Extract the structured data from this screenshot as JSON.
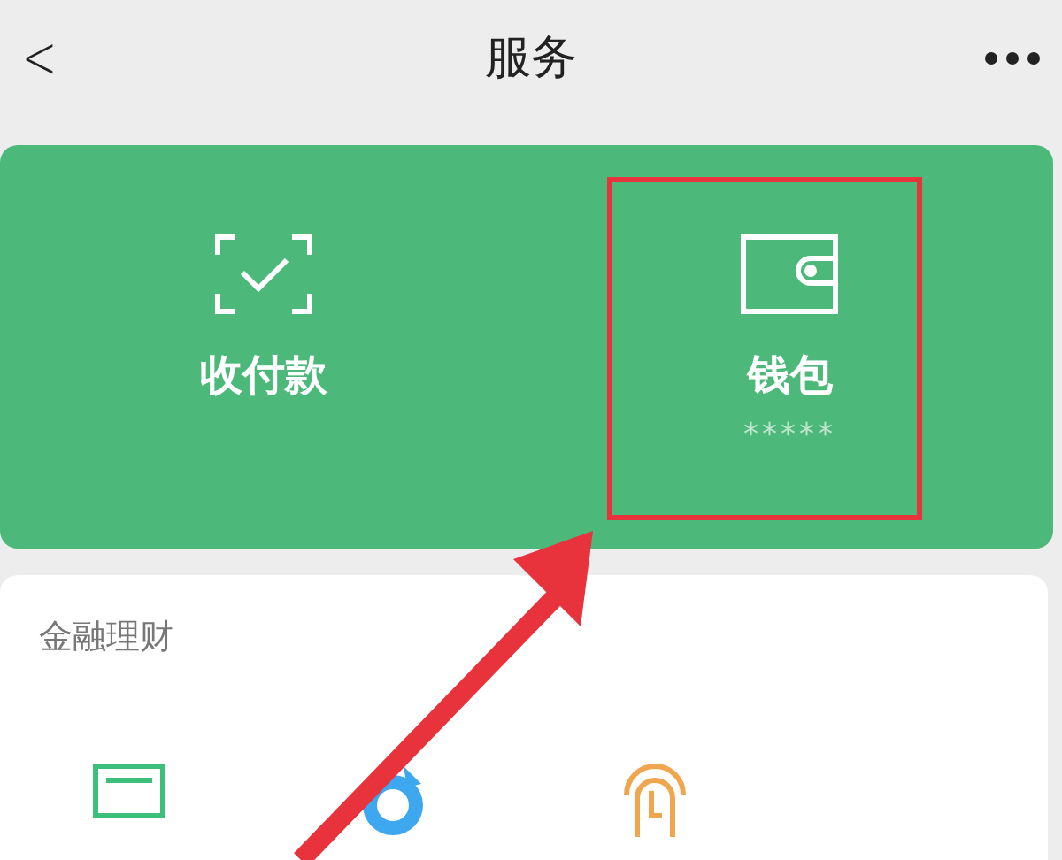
{
  "header": {
    "back": "<",
    "title": "服务"
  },
  "pay_card": {
    "items": [
      {
        "kind": "scan",
        "label": "收付款"
      },
      {
        "kind": "wallet",
        "label": "钱包",
        "detail": "*****"
      }
    ]
  },
  "finance": {
    "title": "金融理财",
    "icons": [
      {
        "kind": "card"
      },
      {
        "kind": "round"
      },
      {
        "kind": "head"
      }
    ]
  }
}
